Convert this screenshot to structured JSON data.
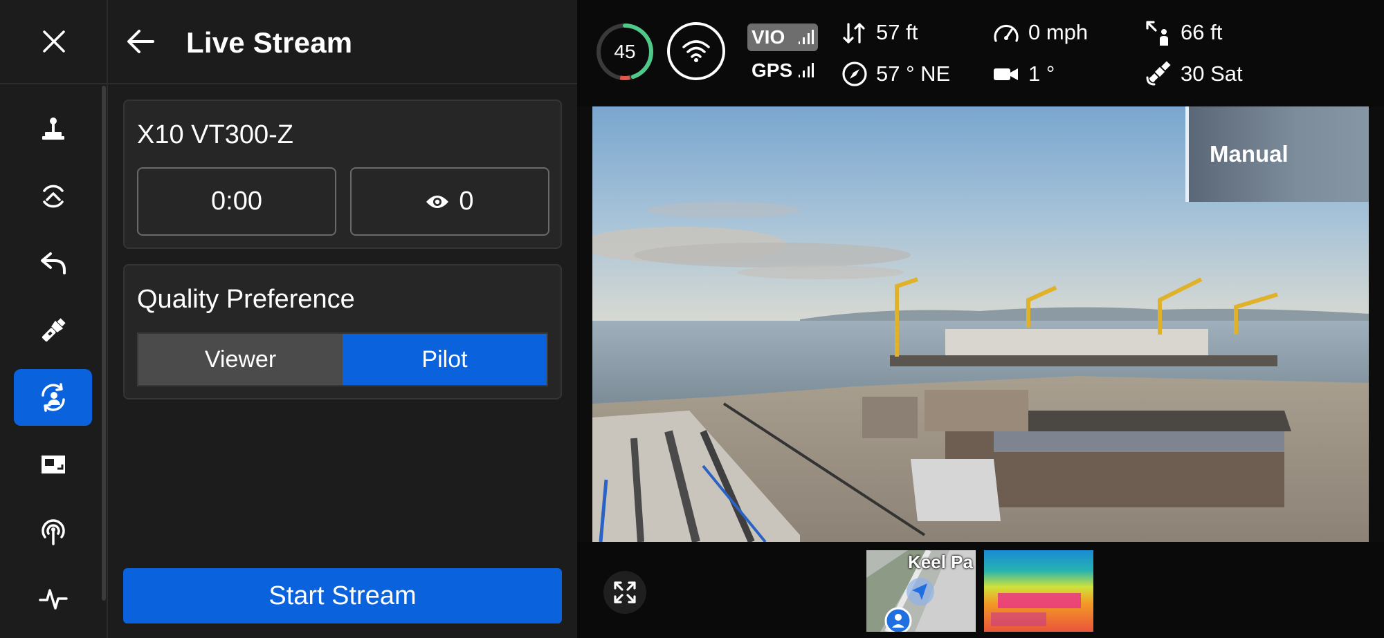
{
  "panel": {
    "title": "Live Stream",
    "device_name": "X10 VT300-Z",
    "timer": "0:00",
    "viewer_count": "0",
    "quality_label": "Quality Preference",
    "quality_options": [
      "Viewer",
      "Pilot"
    ],
    "quality_selected": "Pilot",
    "start_button": "Start Stream"
  },
  "rail": {
    "items": [
      "joystick-icon",
      "fly-to-icon",
      "return-home-icon",
      "flashlight-icon",
      "live-stream-icon",
      "picture-in-picture-icon",
      "antenna-icon",
      "activity-icon"
    ],
    "active_index": 4
  },
  "telemetry": {
    "battery_percent": "45",
    "vio_label": "VIO",
    "gps_label": "GPS",
    "altitude": "57 ft",
    "heading": "57 ° NE",
    "speed": "0 mph",
    "gimbal_angle": "1 °",
    "distance": "66 ft",
    "satellites": "30 Sat"
  },
  "camera": {
    "flight_mode": "Manual"
  },
  "minimap": {
    "label": "Keel Pa"
  },
  "colors": {
    "accent": "#0a63dd",
    "panel_bg": "#1c1c1c",
    "card_bg": "#262626",
    "battery_ring": "#4fc98a"
  }
}
